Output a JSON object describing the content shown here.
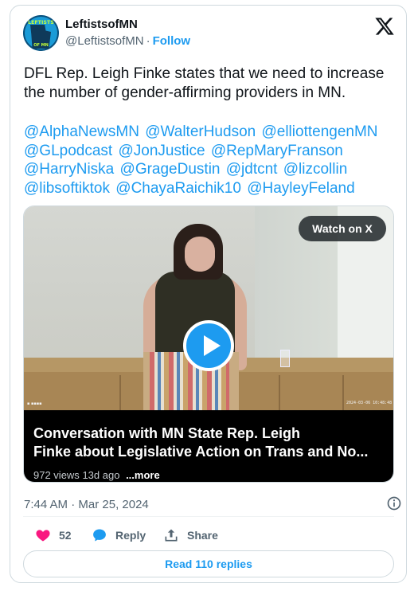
{
  "author": {
    "display_name": "LeftistsofMN",
    "handle": "@LeftistsofMN",
    "separator": "·",
    "follow_label": "Follow",
    "avatar_text_top": "LEFTISTS",
    "avatar_text_bottom": "OF MN"
  },
  "tweet": {
    "text": "DFL Rep. Leigh Finke states that we need to increase the number of gender-affirming providers in MN.",
    "mentions": [
      "@AlphaNewsMN",
      "@WalterHudson",
      "@elliottengenMN",
      "@GLpodcast",
      "@JonJustice",
      "@RepMaryFranson",
      "@HarryNiska",
      "@GrageDustin",
      "@jdtcnt",
      "@lizcollin",
      "@libsoftiktok",
      "@ChayaRaichik10",
      "@HayleyFeland"
    ]
  },
  "media": {
    "watch_label": "Watch on X",
    "title_line1": "Conversation with MN State Rep. Leigh",
    "title_line2": "Finke about Legislative Action on Trans and No...",
    "views": "972 views",
    "age": "13d ago",
    "more_label": "...more",
    "video_timestamp": "2024-03-06 10:48:48"
  },
  "meta": {
    "posted_time": "7:44 AM",
    "separator": "·",
    "posted_date": "Mar 25, 2024"
  },
  "actions": {
    "like_count": "52",
    "reply_label": "Reply",
    "share_label": "Share",
    "read_replies_label": "Read 110 replies"
  },
  "colors": {
    "accent": "#1d9bf0",
    "like_pink": "#f91880",
    "text_primary": "#0f1419",
    "text_secondary": "#536471",
    "border": "#cfd9de"
  },
  "icons": {
    "x_logo": "x-logo-icon",
    "play": "play-icon",
    "info": "info-icon",
    "heart": "heart-icon",
    "reply": "speech-bubble-icon",
    "share": "share-upload-icon"
  }
}
